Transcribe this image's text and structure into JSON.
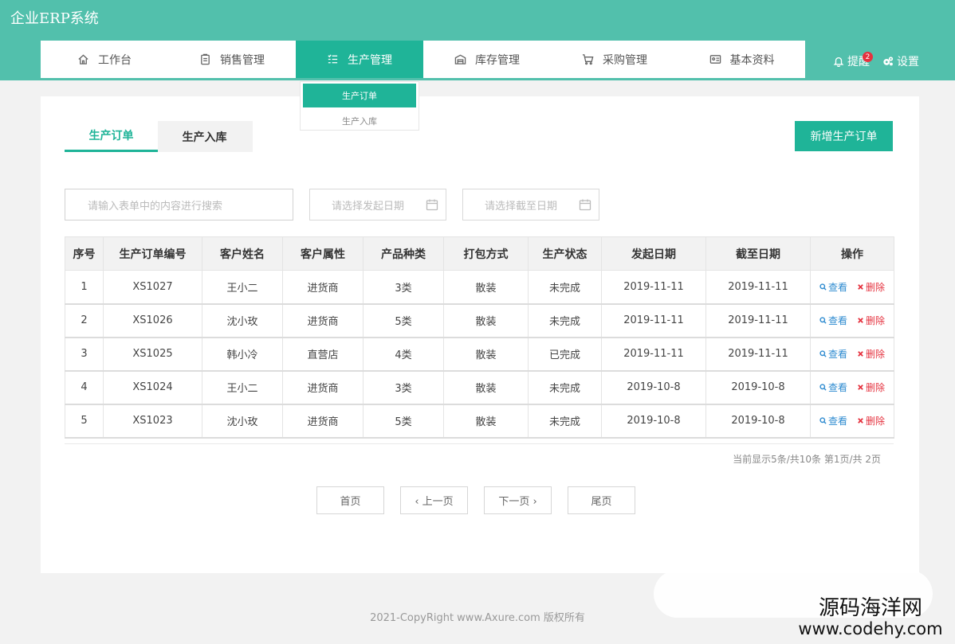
{
  "app": {
    "title": "企业ERP系统"
  },
  "nav": {
    "items": [
      {
        "label": "工作台",
        "icon": "home-icon"
      },
      {
        "label": "销售管理",
        "icon": "clipboard-icon"
      },
      {
        "label": "生产管理",
        "icon": "list-icon",
        "active": true
      },
      {
        "label": "库存管理",
        "icon": "warehouse-icon"
      },
      {
        "label": "采购管理",
        "icon": "cart-icon"
      },
      {
        "label": "基本资料",
        "icon": "id-card-icon"
      }
    ],
    "remind_label": "提醒",
    "remind_badge": "2",
    "settings_label": "设置"
  },
  "dropdown": {
    "items": [
      {
        "label": "生产订单",
        "active": true
      },
      {
        "label": "生产入库"
      }
    ]
  },
  "tabs": [
    {
      "label": "生产订单",
      "active": true
    },
    {
      "label": "生产入库"
    }
  ],
  "add_button": "新增生产订单",
  "filters": {
    "search_placeholder": "请输入表单中的内容进行搜索",
    "start_date_placeholder": "请选择发起日期",
    "end_date_placeholder": "请选择截至日期"
  },
  "table": {
    "headers": [
      "序号",
      "生产订单编号",
      "客户姓名",
      "客户属性",
      "产品种类",
      "打包方式",
      "生产状态",
      "发起日期",
      "截至日期",
      "操作"
    ],
    "rows": [
      [
        "1",
        "XS1027",
        "王小二",
        "进货商",
        "3类",
        "散装",
        "未完成",
        "2019-11-11",
        "2019-11-11"
      ],
      [
        "2",
        "XS1026",
        "沈小玫",
        "进货商",
        "5类",
        "散装",
        "未完成",
        "2019-11-11",
        "2019-11-11"
      ],
      [
        "3",
        "XS1025",
        "韩小冷",
        "直营店",
        "4类",
        "散装",
        "已完成",
        "2019-11-11",
        "2019-11-11"
      ],
      [
        "4",
        "XS1024",
        "王小二",
        "进货商",
        "3类",
        "散装",
        "未完成",
        "2019-10-8",
        "2019-10-8"
      ],
      [
        "5",
        "XS1023",
        "沈小玫",
        "进货商",
        "5类",
        "散装",
        "未完成",
        "2019-10-8",
        "2019-10-8"
      ]
    ],
    "view_label": "查看",
    "delete_label": "删除"
  },
  "pagination": {
    "info": "当前显示5条/共10条 第1页/共 2页",
    "first": "首页",
    "prev": "‹ 上一页",
    "next": "下一页 ›",
    "last": "尾页"
  },
  "footer": "2021-CopyRight www.Axure.com 版权所有",
  "watermark": {
    "line1": "源码海洋网",
    "line2": "www.codehy.com"
  },
  "colors": {
    "header": "#52c0ac",
    "accent": "#1fb498",
    "danger": "#e5323f",
    "link": "#2e8bd0"
  }
}
